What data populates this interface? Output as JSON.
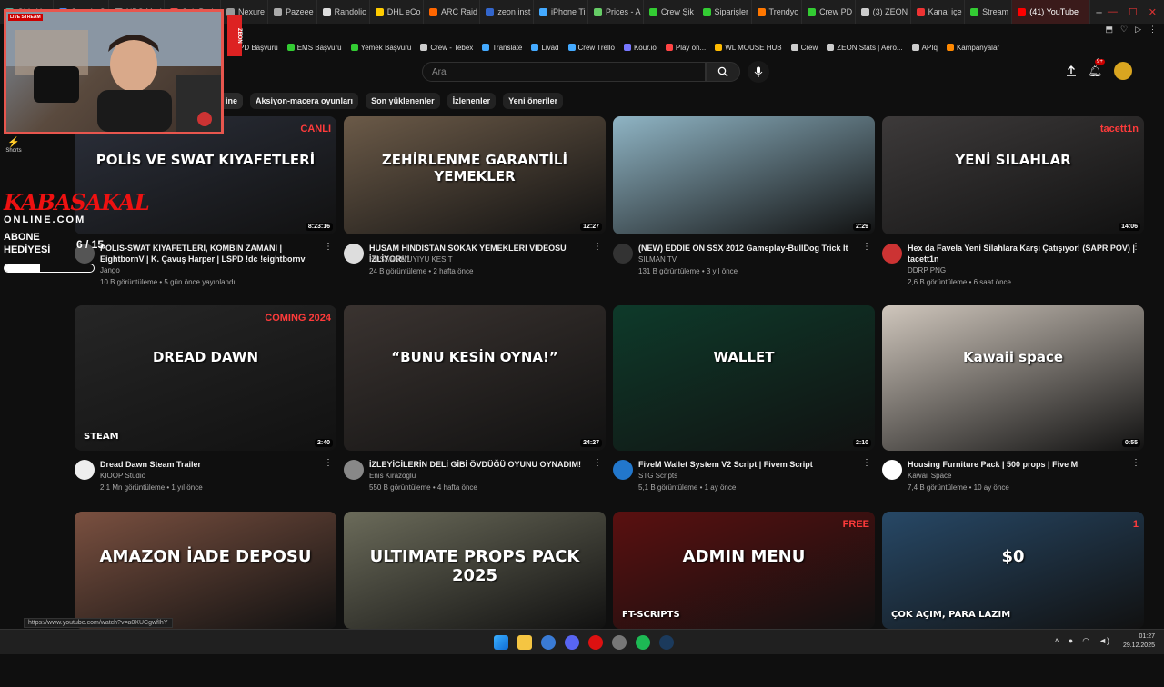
{
  "browser": {
    "tabs": [
      {
        "label": "Giriş Yap",
        "color": "#4a9"
      },
      {
        "label": "Google G",
        "color": "#4285f4"
      },
      {
        "label": "NPC Mod",
        "color": "#888"
      },
      {
        "label": "Sub Badg",
        "color": "#e44"
      },
      {
        "label": "Nexure",
        "color": "#999"
      },
      {
        "label": "Pazeee",
        "color": "#aaa"
      },
      {
        "label": "Randolio",
        "color": "#ddd"
      },
      {
        "label": "DHL eCo",
        "color": "#fc0"
      },
      {
        "label": "ARC Raid",
        "color": "#f60"
      },
      {
        "label": "zeon inst",
        "color": "#36c"
      },
      {
        "label": "iPhone Ti",
        "color": "#4af"
      },
      {
        "label": "Prices - A",
        "color": "#6c6"
      },
      {
        "label": "Crew Şik",
        "color": "#3c3"
      },
      {
        "label": "Siparişler",
        "color": "#3c3"
      },
      {
        "label": "Trendyo",
        "color": "#f70"
      },
      {
        "label": "Crew PD",
        "color": "#3c3"
      },
      {
        "label": "(3) ZEON",
        "color": "#ccc"
      },
      {
        "label": "Kanal içe",
        "color": "#e33"
      },
      {
        "label": "Stream",
        "color": "#3c3"
      }
    ],
    "active_tab": "(41) YouTube",
    "bookmarks": [
      {
        "label": "PD Başvuru",
        "color": "#3c3"
      },
      {
        "label": "EMS Başvuru",
        "color": "#3c3"
      },
      {
        "label": "Yemek Başvuru",
        "color": "#3c3"
      },
      {
        "label": "Crew - Tebex",
        "color": "#ccc"
      },
      {
        "label": "Translate",
        "color": "#4af"
      },
      {
        "label": "Livad",
        "color": "#4af"
      },
      {
        "label": "Crew Trello",
        "color": "#4af"
      },
      {
        "label": "Kour.io",
        "color": "#77f"
      },
      {
        "label": "Play on...",
        "color": "#f44"
      },
      {
        "label": "WL MOUSE HUB",
        "color": "#fb0"
      },
      {
        "label": "Crew",
        "color": "#ccc"
      },
      {
        "label": "ZEON Stats | Aero...",
        "color": "#ccc"
      },
      {
        "label": "APIq",
        "color": "#ccc"
      },
      {
        "label": "Kampanyalar",
        "color": "#f80"
      }
    ]
  },
  "youtube": {
    "search_placeholder": "Ara",
    "notif_count": "9+",
    "chips": [
      "ine",
      "Aksiyon-macera oyunları",
      "Son yüklenenler",
      "İzlenenler",
      "Yeni öneriler"
    ],
    "rail": [
      "Shorts"
    ]
  },
  "videos": [
    {
      "title": "POLİS-SWAT KIYAFETLERİ, KOMBİN ZAMANI | EightbornV | K. Çavuş Harper | LSPD !dc !eightbornv",
      "channel": "Jango",
      "meta": "10 B görüntüleme • 5 gün önce yayınlandı",
      "duration": "8:23:16",
      "thumb_text": "POLİS VE SWAT KIYAFETLERİ",
      "thumb_badge": "CANLI",
      "bg": "#2b2f3a",
      "avatar": "#555"
    },
    {
      "title": "HUSAM HİNDİSTAN SOKAK YEMEKLERİ VİDEOSU İZLİYOR!!!",
      "channel": "HUSAMVIVUYIYU KESİT",
      "meta": "24 B görüntüleme • 2 hafta önce",
      "duration": "12:27",
      "thumb_text": "ZEHİRLENME GARANTİLİ YEMEKLER",
      "bg": "#6b5a48",
      "avatar": "#ddd"
    },
    {
      "title": "(NEW) EDDIE ON SSX 2012 Gameplay-BullDog Trick It",
      "channel": "SILMAN TV",
      "meta": "131 B görüntüleme • 3 yıl önce",
      "duration": "2:29",
      "bg": "#8fb4c4",
      "avatar": "#333"
    },
    {
      "title": "Hex da Favela Yeni Silahlara Karşı Çatışıyor! (SAPR POV) | tacett1n",
      "channel": "DDRP PNG",
      "meta": "2,6 B görüntüleme • 6 saat önce",
      "duration": "14:06",
      "thumb_text": "YENİ SILAHLAR",
      "thumb_badge": "tacett1n",
      "bg": "#3d3a3a",
      "avatar": "#c33"
    },
    {
      "title": "Dread Dawn Steam Trailer",
      "channel": "KIOOP Studio",
      "meta": "2,1 Mn görüntüleme • 1 yıl önce",
      "duration": "2:40",
      "thumb_text": "DREAD DAWN",
      "thumb_badge": "COMING 2024",
      "thumb_sub": "STEAM",
      "bg": "#262626",
      "avatar": "#eee"
    },
    {
      "title": "İZLEYİCİLERİN DELİ GİBİ ÖVDÜĞÜ OYUNU OYNADIM!",
      "channel": "Enis Kirazoglu",
      "meta": "550 B görüntüleme • 4 hafta önce",
      "duration": "24:27",
      "thumb_text": "“BUNU KESİN OYNA!”",
      "bg": "#3a3330",
      "avatar": "#888"
    },
    {
      "title": "FiveM Wallet System V2 Script | Fivem Script",
      "channel": "STG Scripts",
      "meta": "5,1 B görüntüleme • 1 ay önce",
      "duration": "2:10",
      "thumb_text": "WALLET",
      "bg": "#0e3a2a",
      "avatar": "#27c"
    },
    {
      "title": "Housing Furniture Pack | 500 props | Five M",
      "channel": "Kawaii Space",
      "meta": "7,4 B görüntüleme • 10 ay önce",
      "duration": "0:55",
      "thumb_text": "Kawaii space",
      "bg": "#cfc6bc",
      "avatar": "#fff"
    },
    {
      "title": "",
      "channel": "",
      "meta": "",
      "duration": "",
      "thumb_text": "AMAZON İADE DEPOSU",
      "bg": "#7a5040",
      "avatar": "#444"
    },
    {
      "title": "",
      "channel": "",
      "meta": "",
      "duration": "",
      "thumb_text": "ULTIMATE PROPS PACK 2025",
      "bg": "#6b6b5a",
      "avatar": "#444"
    },
    {
      "title": "",
      "channel": "",
      "meta": "",
      "duration": "",
      "thumb_text": "ADMIN MENU",
      "thumb_badge": "FREE",
      "thumb_sub": "FT-SCRIPTS",
      "bg": "#5a1010",
      "avatar": "#444"
    },
    {
      "title": "",
      "channel": "",
      "meta": "",
      "duration": "",
      "thumb_text": "$0",
      "thumb_badge": "1",
      "thumb_sub": "ÇOK AÇIM, PARA LAZIM",
      "bg": "#274866",
      "avatar": "#444"
    }
  ],
  "overlay": {
    "live_badge": "LIVE STREAM",
    "zeon": "ZEON",
    "brand": "KABASAKAL",
    "brand2": "ONLINE.COM",
    "abone": "ABONE HEDİYESİ",
    "counter": "6 / 15",
    "progress": 0.4
  },
  "status_url": "https://www.youtube.com/watch?v=a0XUCgwfIhY",
  "clock": {
    "time": "01:27",
    "date": "29.12.2025"
  }
}
